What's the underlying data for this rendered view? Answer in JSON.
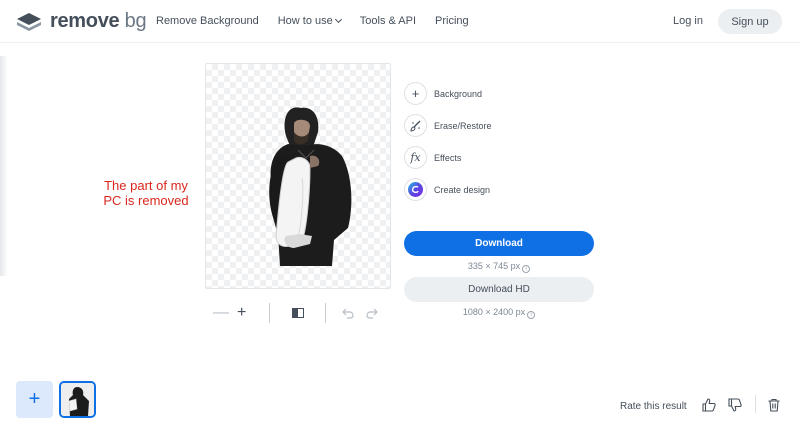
{
  "header": {
    "logo_main": "remove",
    "logo_bg": "bg",
    "nav": [
      "Remove Background",
      "How to use",
      "Tools & API",
      "Pricing"
    ],
    "login": "Log in",
    "signup": "Sign up"
  },
  "annotation": {
    "line1": "The part of my",
    "line2": "PC is removed"
  },
  "options": [
    {
      "label": "Background",
      "icon": "plus-icon"
    },
    {
      "label": "Erase/Restore",
      "icon": "brush-icon"
    },
    {
      "label": "Effects",
      "icon": "fx-icon"
    },
    {
      "label": "Create design",
      "icon": "canva-icon"
    }
  ],
  "download": {
    "label": "Download",
    "size": "335 × 745 px",
    "hd_label": "Download HD",
    "hd_size": "1080 × 2400 px"
  },
  "footer": {
    "rate_label": "Rate this result"
  },
  "colors": {
    "accent": "#0f70e6",
    "annotation": "#d9271e"
  }
}
